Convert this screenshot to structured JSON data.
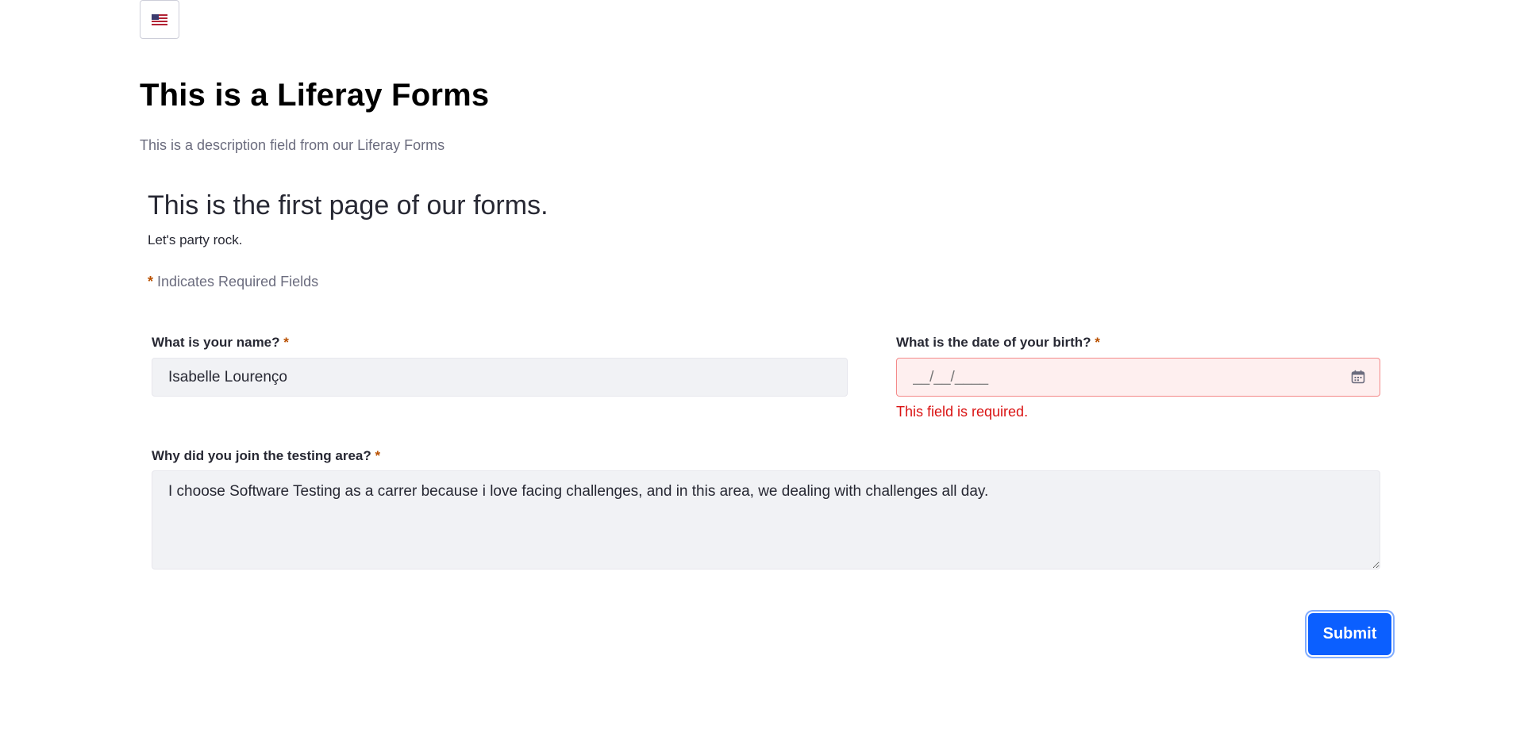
{
  "language": {
    "icon": "us-flag-icon"
  },
  "form": {
    "title": "This is a Liferay Forms",
    "description": "This is a description field from our Liferay Forms"
  },
  "page": {
    "title": "This is the first page of our forms.",
    "description": "Let's party rock.",
    "required_asterisk": "*",
    "required_note": " Indicates Required Fields"
  },
  "fields": {
    "name": {
      "label": "What is your name?",
      "required": "*",
      "value": "Isabelle Lourenço"
    },
    "birth": {
      "label": "What is the date of your birth?",
      "required": "*",
      "placeholder": "__/__/____",
      "icon": "calendar-icon",
      "error": "This field is required.",
      "error_color": "#da1414"
    },
    "why": {
      "label": "Why did you join the testing area?",
      "required": "*",
      "value": "I choose Software Testing as a carrer because i love facing challenges, and in this area, we dealing with challenges all day."
    }
  },
  "actions": {
    "submit_label": "Submit",
    "accent_color": "#0b5fff"
  }
}
